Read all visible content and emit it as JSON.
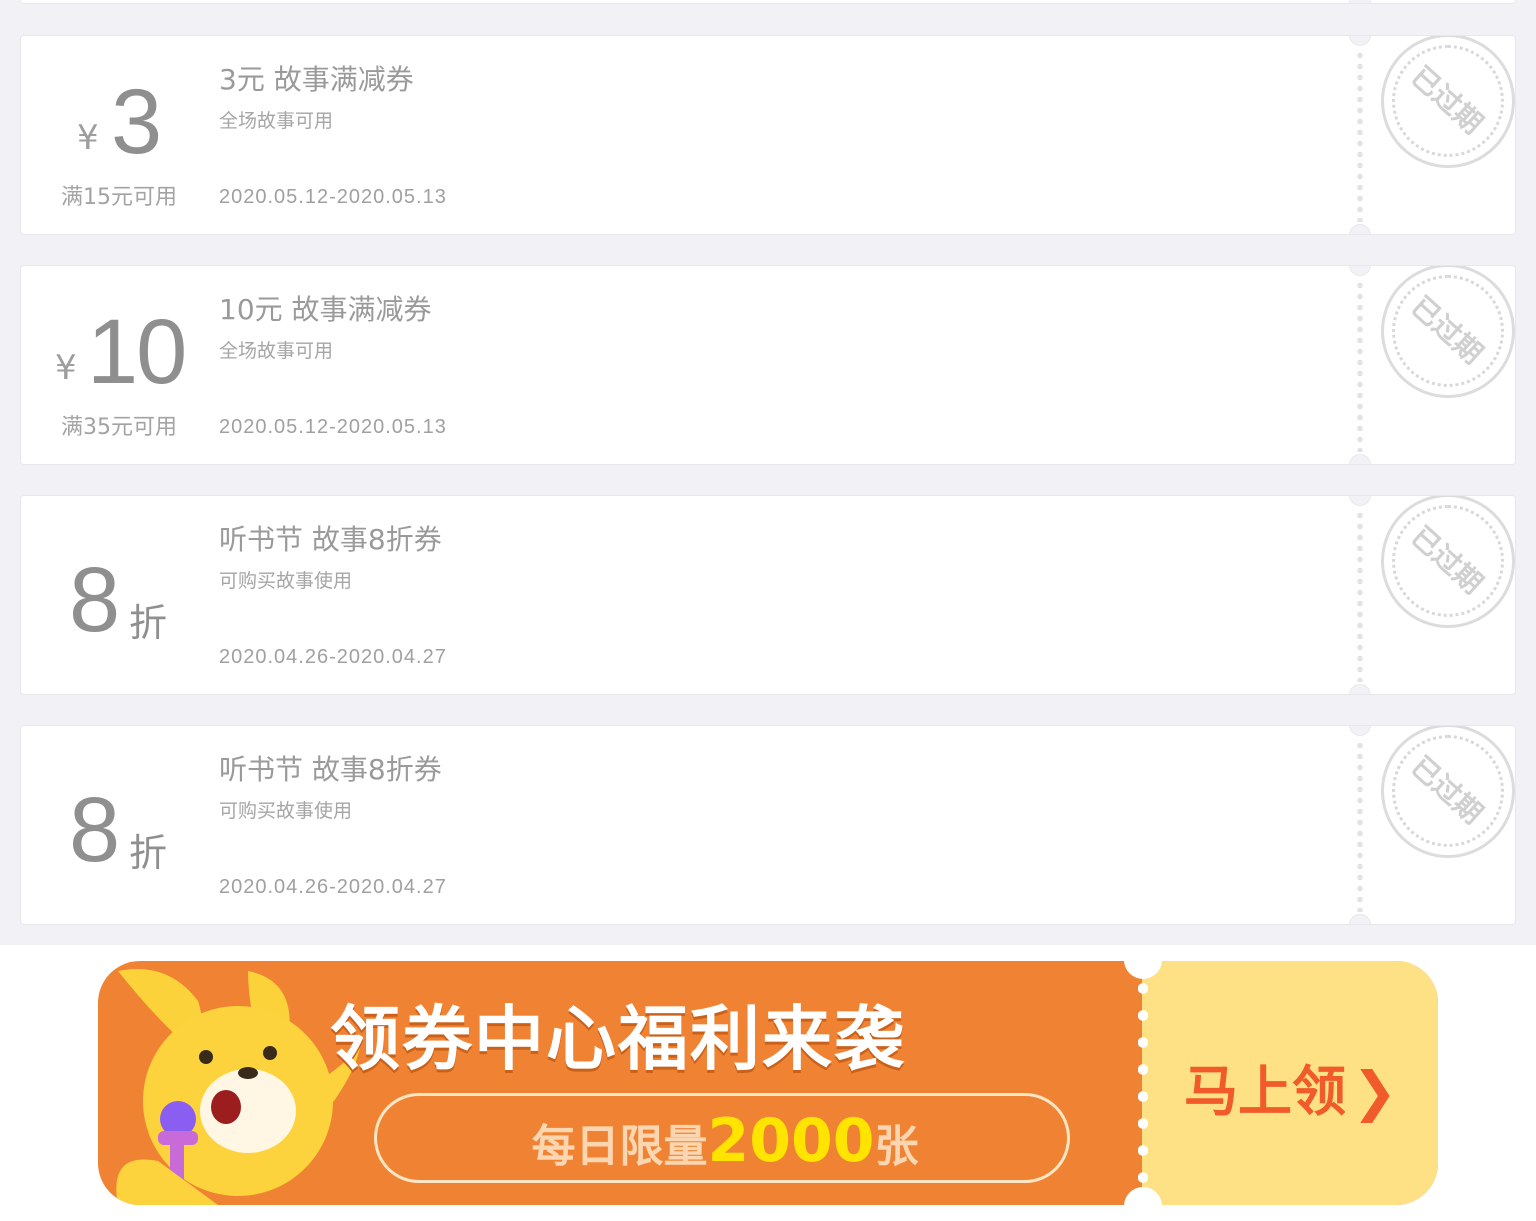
{
  "coupons": [
    {
      "symbol": "¥",
      "amount": "3",
      "condition": "满15元可用",
      "title": "3元 故事满减券",
      "desc": "全场故事可用",
      "date": "2020.05.12-2020.05.13",
      "stamp": "已过期"
    },
    {
      "symbol": "¥",
      "amount": "10",
      "condition": "满35元可用",
      "title": "10元 故事满减券",
      "desc": "全场故事可用",
      "date": "2020.05.12-2020.05.13",
      "stamp": "已过期"
    },
    {
      "amount": "8",
      "unit": "折",
      "title": "听书节 故事8折券",
      "desc": "可购买故事使用",
      "date": "2020.04.26-2020.04.27",
      "stamp": "已过期"
    },
    {
      "amount": "8",
      "unit": "折",
      "title": "听书节 故事8折券",
      "desc": "可购买故事使用",
      "date": "2020.04.26-2020.04.27",
      "stamp": "已过期"
    }
  ],
  "banner": {
    "headline": "领券中心福利来袭",
    "limit_prefix": "每日限量",
    "limit_count": "2000",
    "limit_suffix": "张",
    "cta": "马上领",
    "colors": {
      "orange": "#f08333",
      "yellow_panel": "#fde184",
      "cta_red": "#f15a2a",
      "count_yellow": "#ffe400"
    }
  }
}
